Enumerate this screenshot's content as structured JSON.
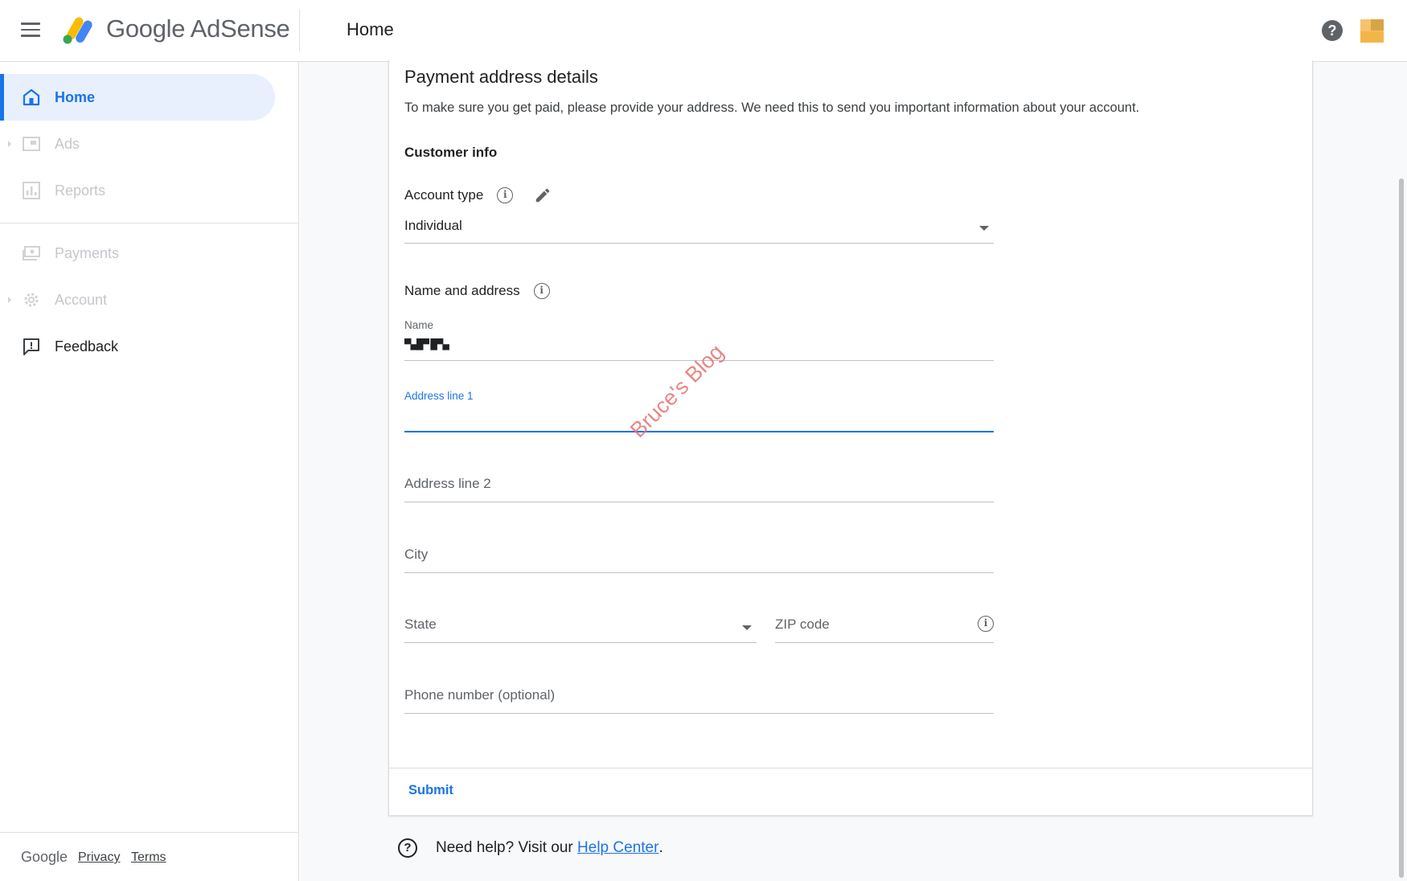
{
  "header": {
    "brand": "Google AdSense",
    "page_title": "Home",
    "help_icon": "help-icon",
    "colors": {
      "accent": "#1a73e8",
      "logo_yellow": "#fbbc04",
      "logo_blue": "#4285f4",
      "logo_green": "#34a853"
    }
  },
  "sidebar": {
    "items": [
      {
        "label": "Home",
        "icon": "home-icon",
        "state": "active"
      },
      {
        "label": "Ads",
        "icon": "ads-icon",
        "state": "disabled",
        "expandable": true
      },
      {
        "label": "Reports",
        "icon": "bar-chart-icon",
        "state": "disabled"
      },
      {
        "label": "Payments",
        "icon": "payments-icon",
        "state": "disabled"
      },
      {
        "label": "Account",
        "icon": "gear-icon",
        "state": "disabled",
        "expandable": true
      },
      {
        "label": "Feedback",
        "icon": "feedback-icon",
        "state": "normal"
      }
    ],
    "footer": {
      "google": "Google",
      "privacy": "Privacy",
      "terms": "Terms"
    }
  },
  "form": {
    "title": "Payment address details",
    "description": "To make sure you get paid, please provide your address. We need this to send you important information about your account.",
    "section": "Customer info",
    "account_type": {
      "label": "Account type",
      "value": "Individual"
    },
    "name_address_label": "Name and address",
    "name": {
      "label": "Name",
      "value": "▀▄█▀ █▀▄"
    },
    "address1": {
      "label": "Address line 1",
      "value": ""
    },
    "address2": {
      "placeholder": "Address line 2"
    },
    "city": {
      "placeholder": "City"
    },
    "state": {
      "placeholder": "State"
    },
    "zip": {
      "placeholder": "ZIP code"
    },
    "phone": {
      "placeholder": "Phone number (optional)"
    },
    "submit": "Submit"
  },
  "help": {
    "text": "Need help? Visit our",
    "link": "Help Center",
    "period": "."
  },
  "watermark": "Bruce's Blog"
}
